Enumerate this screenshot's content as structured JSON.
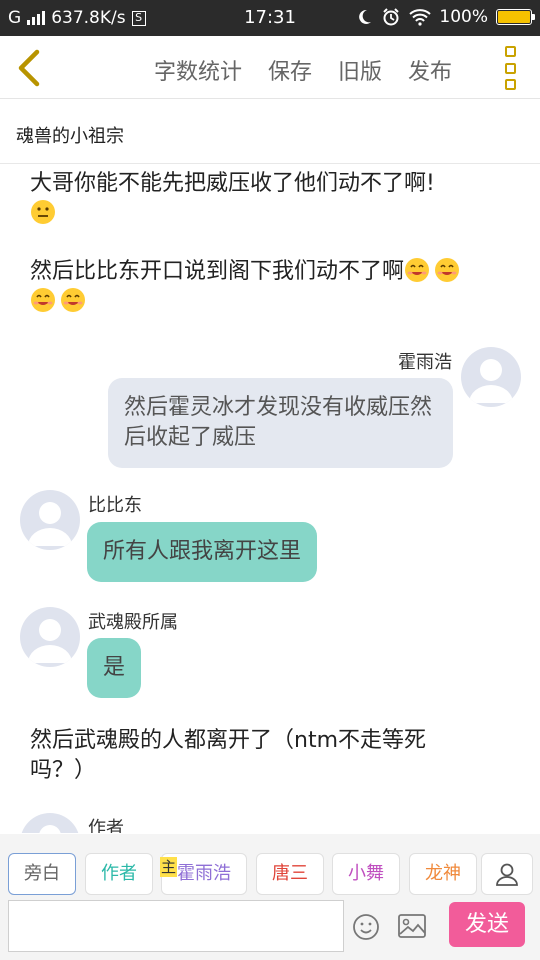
{
  "status_bar": {
    "network": "G",
    "speed": "637.8K/s",
    "sim_badge": "S",
    "time": "17:31",
    "battery": "100%",
    "battery_level": 1.0,
    "icons": [
      "signal-icon",
      "moon-icon",
      "alarm-icon",
      "wifi-icon",
      "battery-icon"
    ]
  },
  "toolbar": {
    "back_icon": "chevron-left-icon",
    "actions": {
      "word_count": "字数统计",
      "save": "保存",
      "old_version": "旧版",
      "publish": "发布"
    },
    "more_icon": "more-vertical-icon",
    "accent_color": "#c9a200"
  },
  "title": "魂兽的小祖宗",
  "messages": {
    "narration_1": "大哥你能不能先把威压收了他们动不了啊!",
    "narration_2": "然后比比东开口说到阁下我们动不了啊",
    "huo_name": "霍雨浩",
    "huo_text": "然后霍灵冰才发现没有收威压然后收起了威压",
    "bibi_name": "比比东",
    "bibi_text": "所有人跟我离开这里",
    "wuhun_name": "武魂殿所属",
    "wuhun_text": "是",
    "narration_3": "然后武魂殿的人都离开了（ntm不走等死吗？）",
    "author_name": "作者",
    "emojis": [
      "confused-face-icon",
      "grin-face-icon",
      "grin-face-icon",
      "grin-face-icon",
      "grin-face-icon"
    ]
  },
  "roles": {
    "narrator": "旁白",
    "author": "作者",
    "main_tag": "主",
    "huo": "霍雨浩",
    "tang": "唐三",
    "xiaowu": "小舞",
    "dragon": "龙神",
    "colors": {
      "author": "#2bb8a8",
      "huo": "#8f6fd6",
      "tang": "#e0453a",
      "xiaowu": "#c04fc0",
      "dragon": "#f08a3c"
    }
  },
  "input": {
    "placeholder": "",
    "send": "发送",
    "send_color": "#f25c9a"
  }
}
